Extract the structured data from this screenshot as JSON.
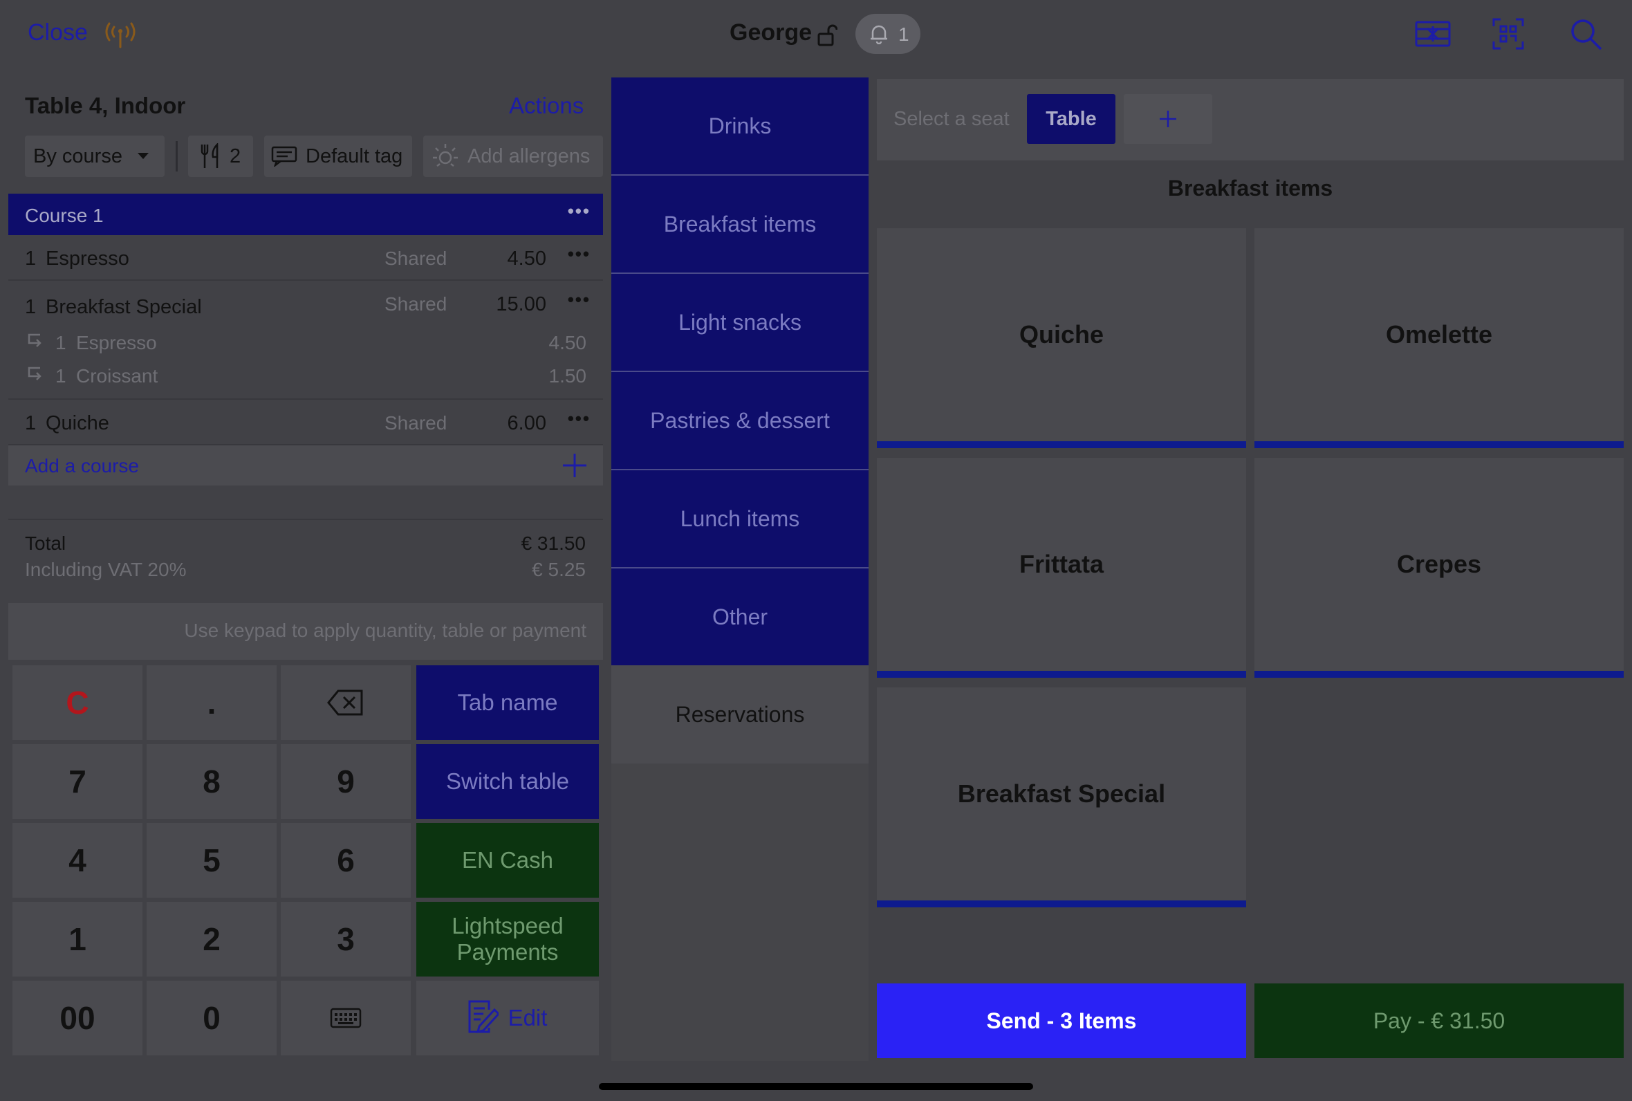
{
  "topbar": {
    "close_label": "Close",
    "user_name": "George",
    "notification_count": "1"
  },
  "order": {
    "title": "Table 4, Indoor",
    "actions_label": "Actions",
    "course_mode": "By course",
    "covers": "2",
    "tag_label": "Default tag",
    "allergens_label": "Add allergens",
    "course_title": "Course 1",
    "items": [
      {
        "qty": "1",
        "name": "Espresso",
        "shared": "Shared",
        "price": "4.50"
      },
      {
        "qty": "1",
        "name": "Breakfast Special",
        "shared": "Shared",
        "price": "15.00",
        "modifiers": [
          {
            "qty": "1",
            "name": "Espresso",
            "price": "4.50"
          },
          {
            "qty": "1",
            "name": "Croissant",
            "price": "1.50"
          }
        ]
      },
      {
        "qty": "1",
        "name": "Quiche",
        "shared": "Shared",
        "price": "6.00"
      }
    ],
    "add_course_label": "Add a course",
    "total_label": "Total",
    "total_value": "€ 31.50",
    "vat_label": "Including VAT 20%",
    "vat_value": "€ 5.25"
  },
  "keypad": {
    "hint": "Use keypad to apply quantity, table or payment",
    "keys": [
      "C",
      ".",
      "7",
      "8",
      "9",
      "4",
      "5",
      "6",
      "1",
      "2",
      "3",
      "00",
      "0"
    ],
    "functions": [
      "Tab name",
      "Switch table",
      "EN Cash",
      "Lightspeed Payments",
      "Edit"
    ]
  },
  "categories": [
    "Drinks",
    "Breakfast items",
    "Light snacks",
    "Pastries & dessert",
    "Lunch items",
    "Other",
    "Reservations"
  ],
  "menu": {
    "seat_label": "Select a seat",
    "seat_table": "Table",
    "section_title": "Breakfast items",
    "products": [
      "Quiche",
      "Omelette",
      "Frittata",
      "Crepes",
      "Breakfast Special"
    ]
  },
  "footer": {
    "send_label": "Send - 3 Items",
    "pay_label": "Pay - € 31.50"
  },
  "colors": {
    "accent_blue": "#0e0d6b",
    "send_blue": "#2a22f5",
    "pay_green": "#0c3410",
    "link_blue": "#1c1ca8",
    "clear_red": "#b3161c"
  },
  "icons": [
    "antenna-icon",
    "lock-icon",
    "bell-icon",
    "card-icon",
    "qr-scan-icon",
    "search-icon",
    "cutlery-icon",
    "tag-icon",
    "allergen-icon",
    "backspace-icon",
    "keyboard-icon",
    "edit-icon",
    "plus-icon",
    "modifier-arrow-icon"
  ]
}
